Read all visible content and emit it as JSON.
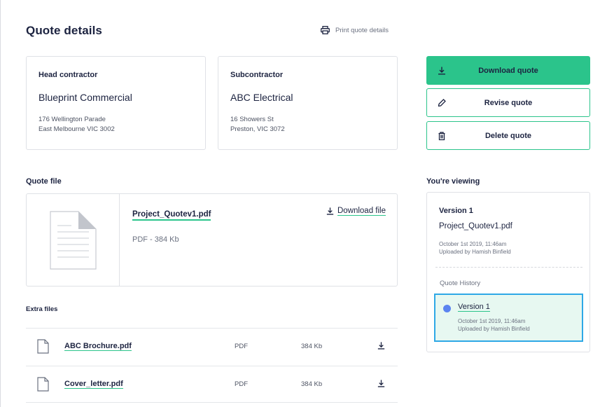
{
  "header": {
    "title": "Quote details",
    "print_label": "Print quote details"
  },
  "parties": {
    "head": {
      "role": "Head contractor",
      "name": "Blueprint Commercial",
      "address_line1": "176 Wellington Parade",
      "address_line2": "East Melbourne VIC 3002"
    },
    "sub": {
      "role": "Subcontractor",
      "name": "ABC Electrical",
      "address_line1": "16 Showers St",
      "address_line2": "Preston, VIC 3072"
    }
  },
  "actions": {
    "download": "Download quote",
    "revise": "Revise quote",
    "delete": "Delete quote"
  },
  "quote_file": {
    "section_label": "Quote file",
    "file_name": "Project_Quotev1.pdf",
    "meta": "PDF - 384 Kb",
    "download_label": "Download file"
  },
  "extra_files": {
    "section_label": "Extra files",
    "rows": [
      {
        "name": "ABC Brochure.pdf",
        "type": "PDF",
        "size": "384 Kb"
      },
      {
        "name": "Cover_letter.pdf",
        "type": "PDF",
        "size": "384 Kb"
      }
    ]
  },
  "viewing": {
    "section_label": "You're viewing",
    "version_title": "Version 1",
    "file_name": "Project_Quotev1.pdf",
    "date": "October 1st 2019, 11:46am",
    "uploaded_by": "Uploaded by Hamish Binfield",
    "history_label": "Quote History",
    "history": [
      {
        "version": "Version 1",
        "date": "October 1st 2019, 11:46am",
        "uploaded_by": "Uploaded by Hamish Binfield"
      }
    ]
  },
  "colors": {
    "accent": "#2bc48b",
    "selected_border": "#2ea8e6",
    "selected_bg": "#e7f8f1",
    "dot": "#5b84f0",
    "text": "#1c2340"
  }
}
